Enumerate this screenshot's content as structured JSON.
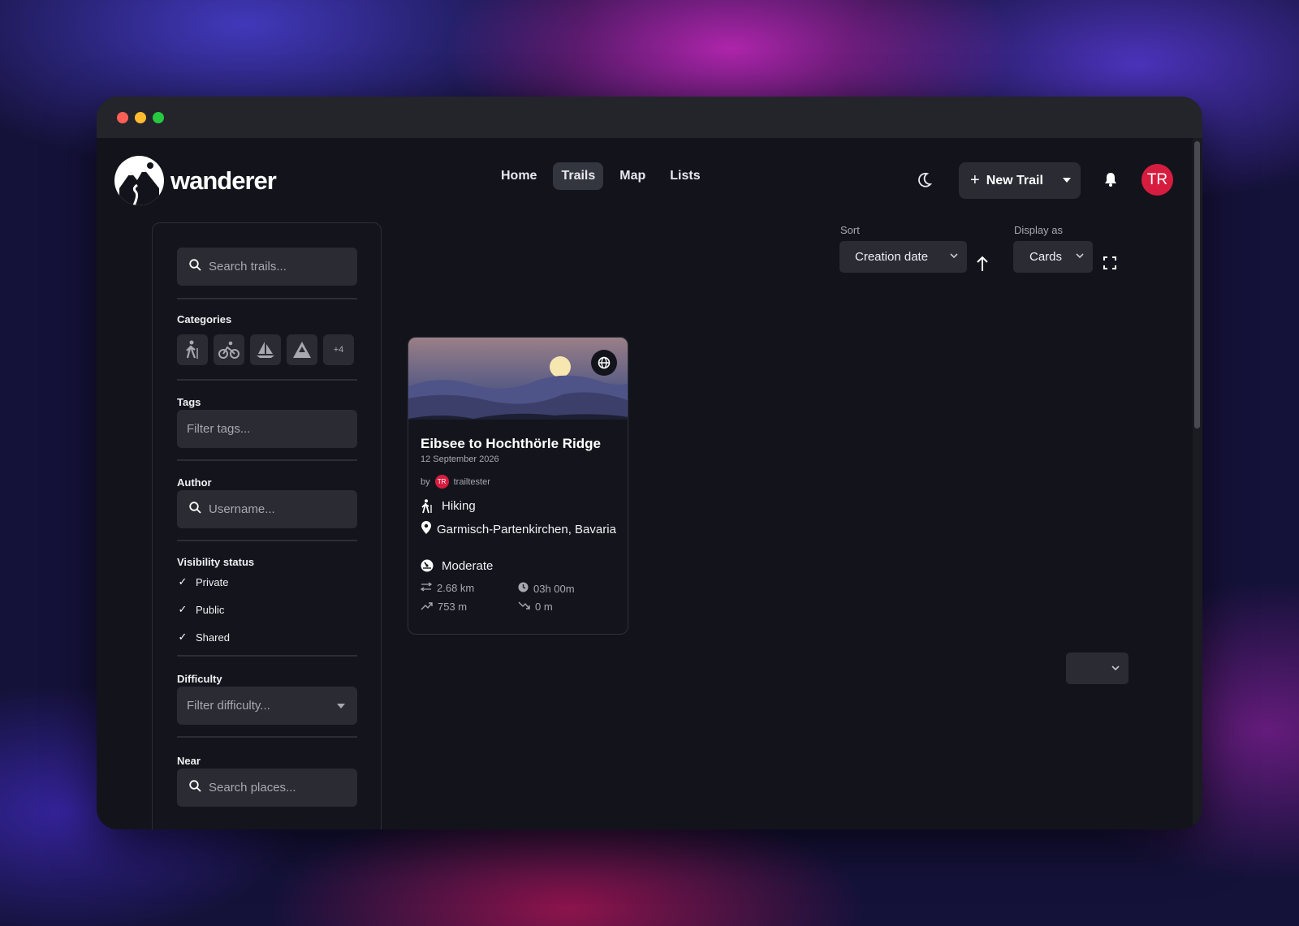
{
  "brand": {
    "name": "wanderer"
  },
  "nav": {
    "items": [
      {
        "label": "Home"
      },
      {
        "label": "Trails"
      },
      {
        "label": "Map"
      },
      {
        "label": "Lists"
      }
    ]
  },
  "header": {
    "new_trail_label": "New Trail",
    "avatar_initials": "TR"
  },
  "sidebar": {
    "search_placeholder": "Search trails...",
    "categories_label": "Categories",
    "categories_more": "+4",
    "tags_label": "Tags",
    "tags_placeholder": "Filter tags...",
    "author_label": "Author",
    "author_placeholder": "Username...",
    "visibility_label": "Visibility status",
    "visibility": [
      {
        "label": "Private",
        "checked": true
      },
      {
        "label": "Public",
        "checked": true
      },
      {
        "label": "Shared",
        "checked": true
      }
    ],
    "difficulty_label": "Difficulty",
    "difficulty_placeholder": "Filter difficulty...",
    "near_label": "Near",
    "near_placeholder": "Search places..."
  },
  "controls": {
    "sort_label": "Sort",
    "sort_value": "Creation date",
    "display_label": "Display as",
    "display_value": "Cards"
  },
  "trail": {
    "title": "Eibsee to Hochthörle Ridge",
    "date": "12 September 2026",
    "by": "by",
    "author_initials": "TR",
    "author": "trailtester",
    "category": "Hiking",
    "location": "Garmisch-Partenkirchen, Bavaria",
    "difficulty": "Moderate",
    "distance": "2.68 km",
    "duration": "03h 00m",
    "elevation_gain": "753 m",
    "elevation_loss": "0 m"
  },
  "colors": {
    "accent": "#d71d3f",
    "background": "#13141b",
    "surface": "#2a2b33"
  }
}
